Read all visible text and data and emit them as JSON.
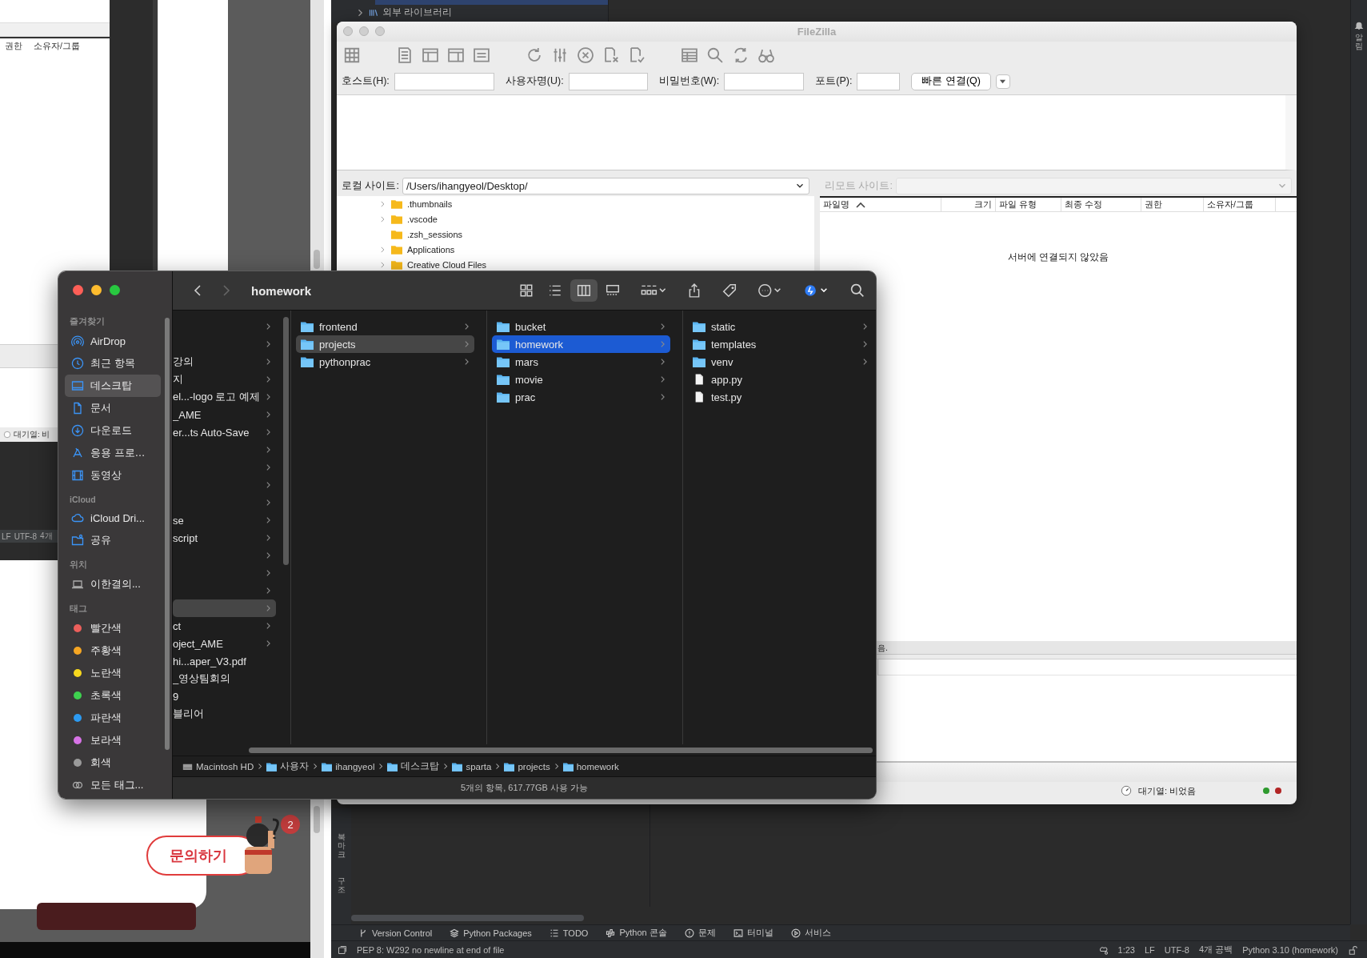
{
  "background_windows": {
    "column_headers": [
      "권한",
      "소유자/그룹"
    ],
    "queue_status": "대기열: 비",
    "status_items": [
      "LF",
      "UTF-8",
      "4개"
    ]
  },
  "inquiry_widget": {
    "label": "문의하기",
    "badge": "2"
  },
  "ide": {
    "tree_item": "외부 라이브러리",
    "right_tab": "알림",
    "side_tabs": [
      "북마크",
      "구조"
    ],
    "tool_tabs": [
      {
        "label": "Version Control",
        "kind": "branch"
      },
      {
        "label": "Python Packages",
        "kind": "layers"
      },
      {
        "label": "TODO",
        "kind": "list"
      },
      {
        "label": "Python 콘솔",
        "kind": "python"
      },
      {
        "label": "문제",
        "kind": "alert"
      },
      {
        "label": "터미널",
        "kind": "terminal"
      },
      {
        "label": "서비스",
        "kind": "play"
      }
    ],
    "status_message": "PEP 8: W292 no newline at end of file",
    "status_items": [
      "1:23",
      "LF",
      "UTF-8",
      "4개 공백",
      "Python 3.10 (homework)"
    ]
  },
  "filezilla": {
    "title": "FileZilla",
    "quickconnect": [
      {
        "label": "호스트(H):"
      },
      {
        "label": "사용자명(U):"
      },
      {
        "label": "비밀번호(W):"
      },
      {
        "label": "포트(P):"
      }
    ],
    "connect_button": "빠른 연결(Q)",
    "local": {
      "label": "로컬 사이트:",
      "path": "/Users/ihangyeol/Desktop/",
      "tree": [
        {
          "name": ".thumbnails",
          "expandable": true
        },
        {
          "name": ".vscode",
          "expandable": true
        },
        {
          "name": ".zsh_sessions",
          "expandable": false
        },
        {
          "name": "Applications",
          "expandable": true
        },
        {
          "name": "Creative Cloud Files",
          "expandable": true
        }
      ]
    },
    "remote": {
      "label": "리모트 사이트:",
      "disabled": true,
      "columns": [
        "파일명",
        "크기",
        "파일 유형",
        "최종 수정",
        "권한",
        "소유자/그룹"
      ],
      "message": "서버에 연결되지 않았음"
    },
    "log_fragment": "음.",
    "queue_status": "대기열: 비었음"
  },
  "finder": {
    "title": "homework",
    "sidebar": [
      {
        "heading": "즐겨찾기",
        "items": [
          {
            "label": "AirDrop",
            "kind": "airdrop",
            "selected": false
          },
          {
            "label": "최근 항목",
            "kind": "clock",
            "selected": false
          },
          {
            "label": "데스크탑",
            "kind": "desktop",
            "selected": true
          },
          {
            "label": "문서",
            "kind": "doc",
            "selected": false
          },
          {
            "label": "다운로드",
            "kind": "download",
            "selected": false
          },
          {
            "label": "응용 프로…",
            "kind": "apps",
            "selected": false
          },
          {
            "label": "동영상",
            "kind": "film",
            "selected": false
          }
        ]
      },
      {
        "heading": "iCloud",
        "items": [
          {
            "label": "iCloud Dri...",
            "kind": "cloud",
            "selected": false
          },
          {
            "label": "공유",
            "kind": "shared",
            "selected": false
          }
        ]
      },
      {
        "heading": "위치",
        "items": [
          {
            "label": "이한결의...",
            "kind": "laptop",
            "selected": false
          }
        ]
      },
      {
        "heading": "태그",
        "items": [
          {
            "label": "빨간색",
            "kind": "tag",
            "color": "#ec5f5b",
            "selected": false
          },
          {
            "label": "주황색",
            "kind": "tag",
            "color": "#f5a623",
            "selected": false
          },
          {
            "label": "노란색",
            "kind": "tag",
            "color": "#f7d81e",
            "selected": false
          },
          {
            "label": "초록색",
            "kind": "tag",
            "color": "#3ed24f",
            "selected": false
          },
          {
            "label": "파란색",
            "kind": "tag",
            "color": "#2c9af1",
            "selected": false
          },
          {
            "label": "보라색",
            "kind": "tag",
            "color": "#d773e6",
            "selected": false
          },
          {
            "label": "회색",
            "kind": "tag",
            "color": "#9a9a9a",
            "selected": false
          },
          {
            "label": "모든 태그...",
            "kind": "all",
            "selected": false
          }
        ]
      }
    ],
    "views": [
      {
        "kind": "icons",
        "selected": false
      },
      {
        "kind": "list",
        "selected": false
      },
      {
        "kind": "columns",
        "selected": true
      },
      {
        "kind": "gallery",
        "selected": false
      }
    ],
    "columns": [
      {
        "items": [
          {
            "expandable": true,
            "selected": false
          },
          {
            "expandable": true,
            "selected": false
          },
          {
            "name": "강의",
            "expandable": true,
            "selected": false
          },
          {
            "name": "지",
            "expandable": true,
            "selected": false
          },
          {
            "name": "el...-logo 로고 예제",
            "expandable": true,
            "selected": false
          },
          {
            "name": "_AME",
            "expandable": true,
            "selected": false
          },
          {
            "name": "er...ts Auto-Save",
            "expandable": true,
            "selected": false
          },
          {
            "expandable": true,
            "selected": false
          },
          {
            "expandable": true,
            "selected": false
          },
          {
            "expandable": true,
            "selected": false
          },
          {
            "expandable": true,
            "selected": false
          },
          {
            "name": "se",
            "expandable": true,
            "selected": false
          },
          {
            "name": "script",
            "expandable": true,
            "selected": false
          },
          {
            "expandable": true,
            "selected": false
          },
          {
            "expandable": true,
            "selected": false
          },
          {
            "expandable": true,
            "selected": false
          },
          {
            "expandable": true,
            "selected": true,
            "focused": false
          },
          {
            "name": "ct",
            "expandable": true,
            "selected": false
          },
          {
            "name": "oject_AME",
            "expandable": true,
            "selected": false
          },
          {
            "name": "hi...aper_V3.pdf",
            "expandable": false,
            "selected": false
          },
          {
            "name": "_영상팀회의",
            "expandable": false,
            "selected": false
          },
          {
            "name": "9",
            "expandable": false,
            "selected": false
          },
          {
            "name": "블리어",
            "expandable": false,
            "selected": false
          }
        ]
      },
      {
        "items": [
          {
            "name": "frontend",
            "kind": "folder",
            "expandable": true,
            "selected": false
          },
          {
            "name": "projects",
            "kind": "folder",
            "expandable": true,
            "selected": true,
            "focused": false
          },
          {
            "name": "pythonprac",
            "kind": "folder",
            "expandable": true,
            "selected": false
          }
        ]
      },
      {
        "items": [
          {
            "name": "bucket",
            "kind": "folder",
            "expandable": true,
            "selected": false
          },
          {
            "name": "homework",
            "kind": "folder",
            "expandable": true,
            "selected": true,
            "focused": true
          },
          {
            "name": "mars",
            "kind": "folder",
            "expandable": true,
            "selected": false
          },
          {
            "name": "movie",
            "kind": "folder",
            "expandable": true,
            "selected": false
          },
          {
            "name": "prac",
            "kind": "folder",
            "expandable": true,
            "selected": false
          }
        ]
      },
      {
        "items": [
          {
            "name": "static",
            "kind": "folder",
            "expandable": true,
            "selected": false
          },
          {
            "name": "templates",
            "kind": "folder",
            "expandable": true,
            "selected": false
          },
          {
            "name": "venv",
            "kind": "folder",
            "expandable": true,
            "selected": false
          },
          {
            "name": "app.py",
            "kind": "file",
            "expandable": false,
            "selected": false
          },
          {
            "name": "test.py",
            "kind": "file",
            "expandable": false,
            "selected": false
          }
        ]
      }
    ],
    "path": [
      {
        "label": "Macintosh HD",
        "kind": "disk"
      },
      {
        "label": "사용자",
        "kind": "folder"
      },
      {
        "label": "ihangyeol",
        "kind": "folder"
      },
      {
        "label": "데스크탑",
        "kind": "folder"
      },
      {
        "label": "sparta",
        "kind": "folder"
      },
      {
        "label": "projects",
        "kind": "folder"
      },
      {
        "label": "homework",
        "kind": "folder"
      }
    ],
    "status": "5개의 항목, 617.77GB 사용 가능"
  }
}
